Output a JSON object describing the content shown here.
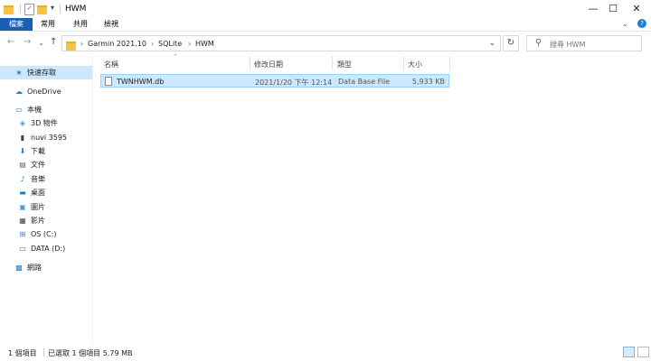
{
  "window": {
    "title": "HWM",
    "controls": {
      "minimize": "—",
      "maximize": "☐",
      "close": "✕"
    }
  },
  "ribbon": {
    "tabs": [
      {
        "label": "檔案"
      },
      {
        "label": "常用"
      },
      {
        "label": "共用"
      },
      {
        "label": "檢視"
      }
    ]
  },
  "address": {
    "crumbs": [
      "Garmin 2021.10",
      "SQLite",
      "HWM"
    ],
    "search_placeholder": "搜尋 HWM"
  },
  "sidebar": {
    "quick_access": "快速存取",
    "onedrive": "OneDrive",
    "this_pc": "本機",
    "items": [
      {
        "label": "3D 物件",
        "icon": "cube-icon"
      },
      {
        "label": "nuvi 3595",
        "icon": "device-icon"
      },
      {
        "label": "下載",
        "icon": "download-icon"
      },
      {
        "label": "文件",
        "icon": "document-icon"
      },
      {
        "label": "音樂",
        "icon": "music-icon"
      },
      {
        "label": "桌面",
        "icon": "desktop-icon"
      },
      {
        "label": "圖片",
        "icon": "pictures-icon"
      },
      {
        "label": "影片",
        "icon": "video-icon"
      },
      {
        "label": "OS (C:)",
        "icon": "drive-icon"
      },
      {
        "label": "DATA (D:)",
        "icon": "drive-icon"
      }
    ],
    "network": "網路"
  },
  "columns": {
    "name": "名稱",
    "modified": "修改日期",
    "type": "類型",
    "size": "大小"
  },
  "files": [
    {
      "name": "TWNHWM.db",
      "modified": "2021/1/20 下午 12:14",
      "type": "Data Base File",
      "size": "5,933 KB"
    }
  ],
  "status": {
    "count": "1 個項目",
    "selected": "已選取 1 個項目 5.79 MB"
  }
}
